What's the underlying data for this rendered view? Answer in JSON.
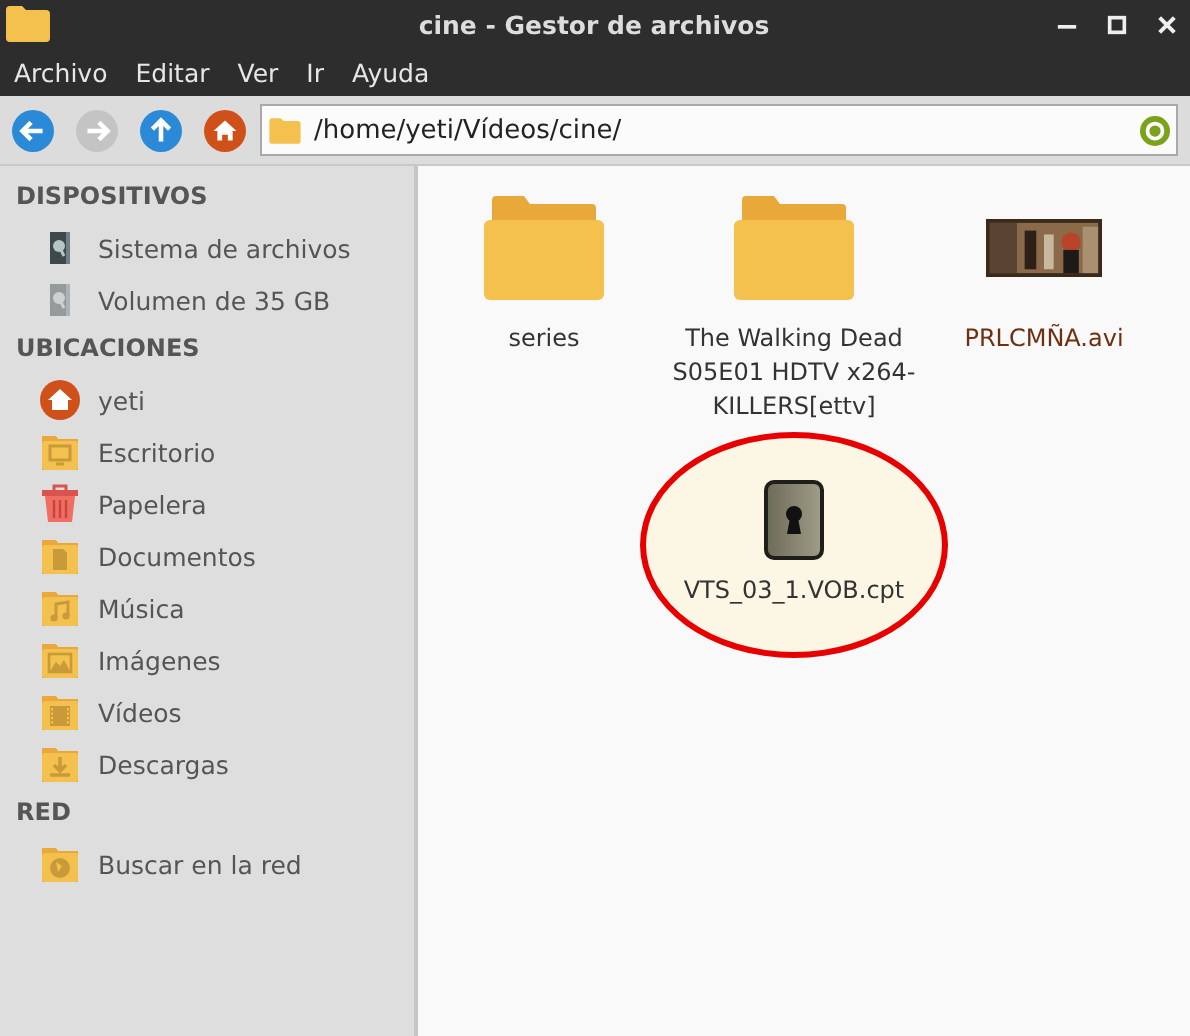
{
  "window": {
    "title": "cine - Gestor de archivos"
  },
  "menu": [
    "Archivo",
    "Editar",
    "Ver",
    "Ir",
    "Ayuda"
  ],
  "toolbar": {
    "buttons": [
      {
        "kind": "back",
        "disabled": false
      },
      {
        "kind": "forward",
        "disabled": true
      },
      {
        "kind": "up",
        "disabled": false
      },
      {
        "kind": "home",
        "disabled": false
      }
    ],
    "path": "/home/yeti/Vídeos/cine/"
  },
  "sidebar": {
    "sections": [
      {
        "title": "DISPOSITIVOS",
        "items": [
          {
            "label": "Sistema de archivos",
            "kind": "drive",
            "mounted": true
          },
          {
            "label": "Volumen de 35 GB",
            "kind": "drive",
            "mounted": false
          }
        ]
      },
      {
        "title": "UBICACIONES",
        "items": [
          {
            "label": "yeti",
            "kind": "home"
          },
          {
            "label": "Escritorio",
            "kind": "desktop"
          },
          {
            "label": "Papelera",
            "kind": "trash"
          },
          {
            "label": "Documentos",
            "kind": "documents"
          },
          {
            "label": "Música",
            "kind": "music"
          },
          {
            "label": "Imágenes",
            "kind": "pictures"
          },
          {
            "label": "Vídeos",
            "kind": "videos"
          },
          {
            "label": "Descargas",
            "kind": "downloads"
          }
        ]
      },
      {
        "title": "RED",
        "items": [
          {
            "label": "Buscar en la red",
            "kind": "network"
          }
        ]
      }
    ]
  },
  "files": [
    {
      "name": "series",
      "kind": "folder",
      "highlighted": false
    },
    {
      "name": "The Walking Dead S05E01 HDTV x264-KILLERS[ettv]",
      "kind": "folder",
      "highlighted": false
    },
    {
      "name": "PRLCMÑA.avi",
      "kind": "video",
      "highlighted": false
    },
    {
      "name": "VTS_03_1.VOB.cpt",
      "kind": "encrypted",
      "highlighted": true
    }
  ]
}
